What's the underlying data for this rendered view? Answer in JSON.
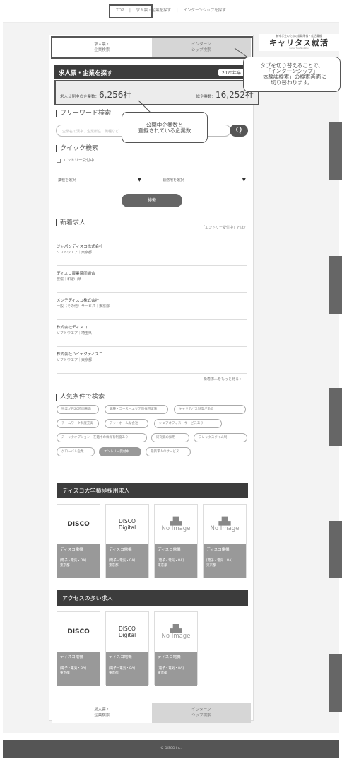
{
  "topnav": {
    "top": "TOP",
    "sep1": "|",
    "search_jobs": "求人票・企業を探す",
    "sep2": "|",
    "search_intern": "インターンシップを探す"
  },
  "tabs": {
    "jobs": [
      "求人票・",
      "企業検索"
    ],
    "intern": [
      "インターン",
      "シップ検索"
    ]
  },
  "ad": {
    "small": "新卒学生のための就職準備・就活情報",
    "logo": "キャリタス就活",
    "tagline": "Career Tasu Shukatsu"
  },
  "header": {
    "title": "求人票・企業を探す",
    "year": "2020年卒"
  },
  "counts": {
    "open_label": "求人公開中の企業数：",
    "open_value": "6,256社",
    "total_label": "総企業数：",
    "total_value": "16,252社"
  },
  "callout_tab": [
    "タブを切り替えることで、",
    "「インターンシップ」",
    "「体験談検索」の検索画面に",
    "切り替わります。"
  ],
  "callout_counts": [
    "公開中企業数と",
    "登録されている企業数"
  ],
  "free": {
    "title": "フリーワード検索",
    "placeholder": "企業名の漢字、企業所在、職種など",
    "btn": "Q"
  },
  "quick": {
    "title": "クイック検索",
    "entry": "エントリー受付中",
    "industry": "業種を選択",
    "location": "勤務地を選択",
    "go": "検索"
  },
  "newjobs": {
    "title": "新着求人",
    "entry_note": "「エントリー受付中」とは？",
    "more": "新着求人をもっと見る ›"
  },
  "jobs": [
    {
      "name": "ジャパンディスコ株式会社",
      "sub": "ソフトウエア｜東京都"
    },
    {
      "name": "ディスコ農業協同組合",
      "sub": "農協｜和歌山県"
    },
    {
      "name": "メンテディスコ株式会社",
      "sub": "一般（その他）サービス｜東京都"
    },
    {
      "name": "株式会社ディスコ",
      "sub": "ソフトウエア｜埼玉県"
    },
    {
      "name": "株式会社ハイテクディスコ",
      "sub": "ソフトウエア｜東京都"
    }
  ],
  "popular": {
    "title": "人気条件で検索",
    "tags": [
      "残業が月20時間未満",
      "職種・コース・エリア別採用実施",
      "キャリアパス制度がある",
      "チームワーク制度充実",
      "アットホームな会社",
      "シェアオフィス・サービスあり",
      "ストックオプション・在籍中の株保有制度あり",
      "研究職の採用",
      "フレックスタイム制",
      "グローバル企業",
      "エントリー受付中",
      "最新求人のサービス"
    ]
  },
  "ranking": {
    "title": "ディスコ大学積極採用求人"
  },
  "access": {
    "title": "アクセスの多い求人"
  },
  "cards": [
    {
      "logo": "DISCO",
      "kind": "bold",
      "name": "ディスコ電機",
      "tag": "[電子・電気・OA]",
      "place": "東京都"
    },
    {
      "logo": "DISCO Digital",
      "kind": "two",
      "name": "ディスコ電機",
      "tag": "[電子・電気・OA]",
      "place": "東京都"
    },
    {
      "logo": "No Image",
      "kind": "noimg",
      "name": "ディスコ電機",
      "tag": "[電子・電気・OA]",
      "place": "東京都"
    },
    {
      "logo": "No Image",
      "kind": "noimg",
      "name": "ディスコ電機",
      "tag": "[電子・電気・OA]",
      "place": "東京都"
    }
  ],
  "cards2": [
    {
      "logo": "DISCO",
      "kind": "bold",
      "name": "ディスコ電機",
      "tag": "[電子・電気・OA]",
      "place": "東京都"
    },
    {
      "logo": "DISCO Digital",
      "kind": "two",
      "name": "ディスコ電機",
      "tag": "[電子・電気・OA]",
      "place": "東京都"
    },
    {
      "logo": "No Image",
      "kind": "noimg",
      "name": "ディスコ電機",
      "tag": "[電子・電気・OA]",
      "place": "東京都"
    }
  ],
  "footer": {
    "copyright": "© DISCO Inc."
  },
  "icons": {
    "building": "building-icon",
    "search": "search-icon",
    "dropdown": "caret-down-icon"
  }
}
